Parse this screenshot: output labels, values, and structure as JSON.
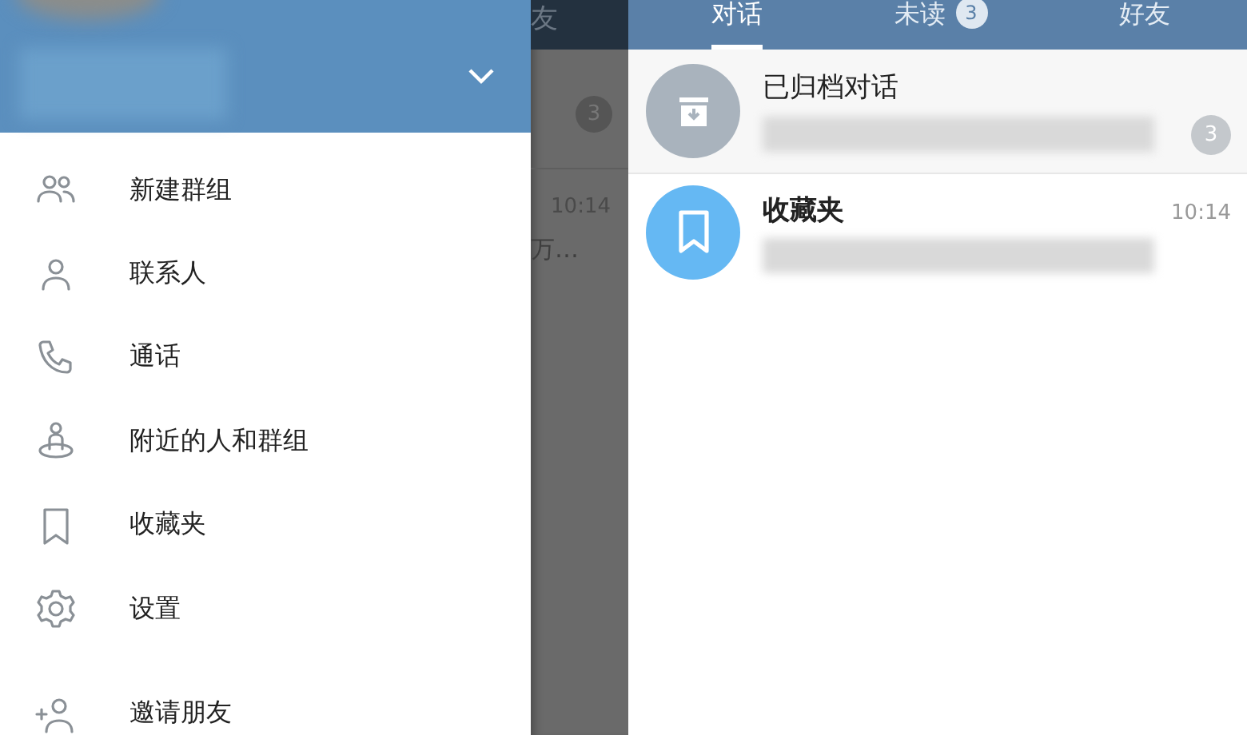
{
  "drawer": {
    "menu": [
      {
        "kind": "group",
        "label": "新建群组"
      },
      {
        "kind": "contact",
        "label": "联系人"
      },
      {
        "kind": "call",
        "label": "通话"
      },
      {
        "kind": "nearby",
        "label": "附近的人和群组"
      },
      {
        "kind": "saved",
        "label": "收藏夹"
      },
      {
        "kind": "settings",
        "label": "设置"
      }
    ],
    "footer_menu": [
      {
        "kind": "invite",
        "label": "邀请朋友"
      }
    ]
  },
  "background_list": {
    "header_text": "友",
    "badge": "3",
    "time": "10:14",
    "preview": "万…"
  },
  "tabs": [
    {
      "label": "对话",
      "selected": true
    },
    {
      "label": "未读",
      "selected": false,
      "badge": "3"
    },
    {
      "label": "好友",
      "selected": false
    }
  ],
  "chats": [
    {
      "kind": "archive",
      "title": "已归档对话",
      "badge": "3"
    },
    {
      "kind": "saved",
      "title": "收藏夹",
      "time": "10:14"
    }
  ]
}
